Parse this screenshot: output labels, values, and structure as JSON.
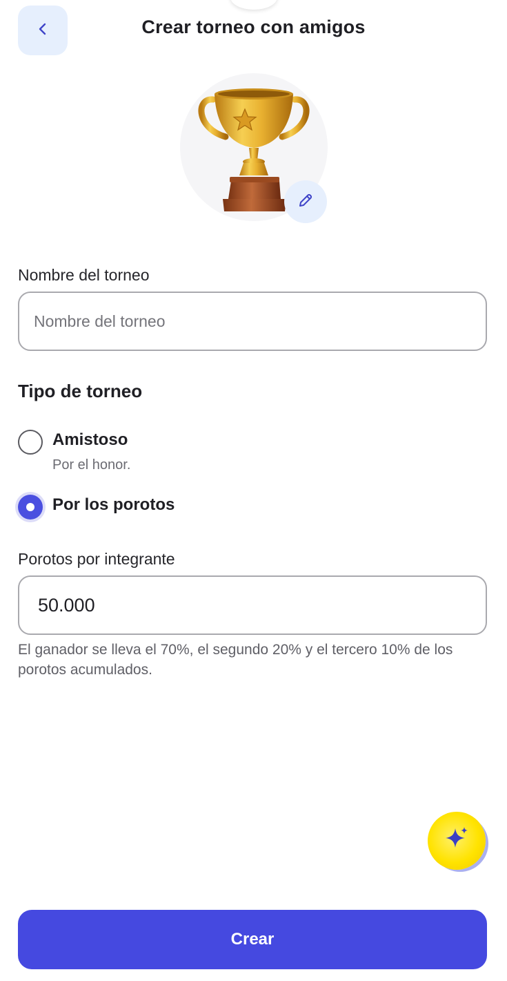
{
  "header": {
    "title": "Crear torneo con amigos",
    "back_icon": "chevron-left-icon"
  },
  "avatar": {
    "image": "trophy-icon",
    "edit_icon": "pencil-icon"
  },
  "name_field": {
    "label": "Nombre del torneo",
    "placeholder": "Nombre del torneo",
    "value": ""
  },
  "tournament_type": {
    "title": "Tipo de torneo",
    "options": [
      {
        "label": "Amistoso",
        "description": "Por el honor.",
        "selected": false
      },
      {
        "label": "Por los porotos",
        "selected": true
      }
    ]
  },
  "amount_field": {
    "label": "Porotos por integrante",
    "value": "50.000",
    "helper": "El ganador se lleva el 70%, el segundo 20% y el tercero 10% de los porotos acumulados."
  },
  "fab": {
    "icon": "sparkle-icon"
  },
  "submit": {
    "label": "Crear"
  },
  "colors": {
    "accent": "#4549e0",
    "light_blue": "#e6effd",
    "fab_yellow": "#ffe300"
  }
}
